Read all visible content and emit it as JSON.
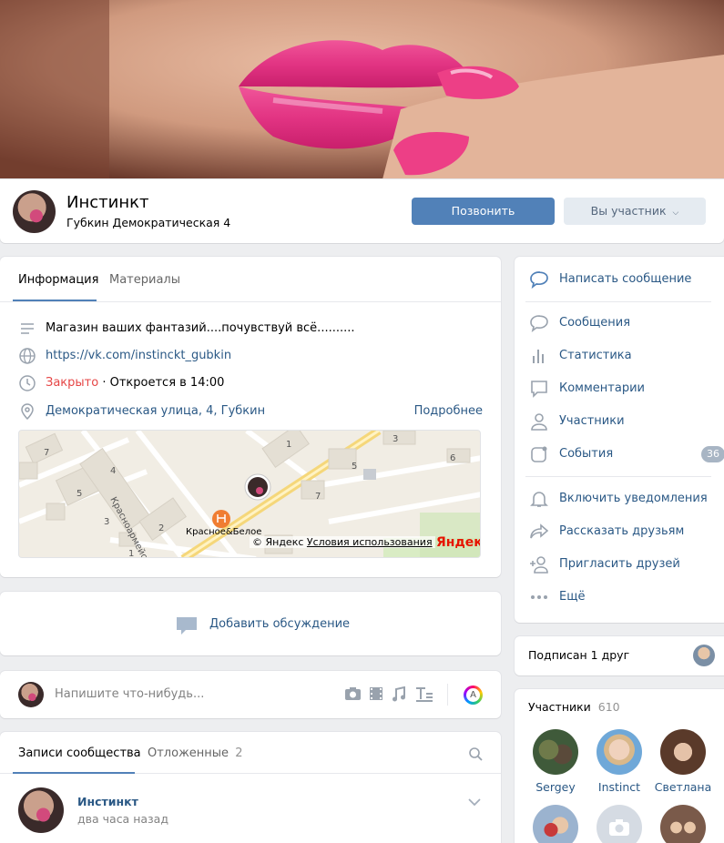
{
  "group": {
    "name": "Инстинкт",
    "subtitle": "Губкин Демократическая 4"
  },
  "actions": {
    "call_label": "Позвонить",
    "member_label": "Вы участник"
  },
  "info_tabs": [
    "Информация",
    "Материалы"
  ],
  "info": {
    "description": "Магазин ваших фантазий....почувствуй всё..........",
    "website": "https://vk.com/instinckt_gubkin",
    "status_closed": "Закрыто",
    "status_opens": "· Откроется в 14:00",
    "address": "Демократическая улица, 4, Губкин",
    "more": "Подробнее"
  },
  "map": {
    "street_label": "Красноармейская",
    "store_label": "Красное&Белое",
    "credit": "© Яндекс",
    "terms": "Условия использования",
    "logo": "Яндекс",
    "house_numbers": [
      "7",
      "4",
      "5",
      "3",
      "2",
      "1",
      "1",
      "3",
      "5",
      "7",
      "6"
    ]
  },
  "discussion": {
    "add_label": "Добавить обсуждение"
  },
  "composer": {
    "placeholder": "Напишите что-нибудь..."
  },
  "posts": {
    "tab_community": "Записи сообщества",
    "tab_postponed": "Отложенные",
    "postponed_count": "2",
    "first_post": {
      "author": "Инстинкт",
      "time": "два часа назад"
    }
  },
  "menu": {
    "write_message": "Написать сообщение",
    "messages": "Сообщения",
    "statistics": "Статистика",
    "comments": "Комментарии",
    "members": "Участники",
    "events": "События",
    "events_count": "36",
    "notifications": "Включить уведомления",
    "share": "Рассказать друзьям",
    "invite": "Пригласить друзей",
    "more": "Ещё"
  },
  "friends": {
    "label": "Подписан 1 друг"
  },
  "members": {
    "title": "Участники",
    "count": "610",
    "list": [
      {
        "name": "Sergey"
      },
      {
        "name": "Instinct"
      },
      {
        "name": "Светлана"
      }
    ]
  },
  "colors": {
    "accent": "#5181b8",
    "link": "#2a5885",
    "closed": "#e64646",
    "background": "#edeef0"
  }
}
